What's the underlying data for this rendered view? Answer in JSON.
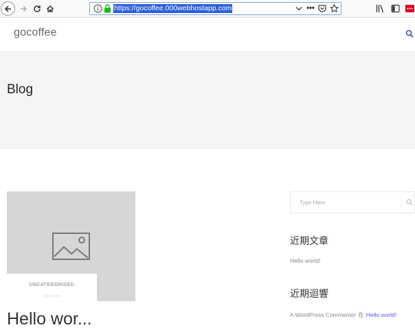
{
  "browser": {
    "url": "https://gocoffee.000webhostapp.com",
    "more_label": "•••"
  },
  "site": {
    "title": "gocoffee"
  },
  "page": {
    "title": "Blog"
  },
  "post": {
    "category": "UNCATEGORISED",
    "title": "Hello wor..."
  },
  "sidebar": {
    "search_placeholder": "Type Here",
    "recent_posts_heading": "近期文章",
    "recent_posts": [
      "Hello world!"
    ],
    "recent_comments_heading": "近期迴響",
    "comment": {
      "author": "A WordPress Commenter",
      "connector": "在",
      "post_title": "Hello world!"
    }
  },
  "colors": {
    "link_accent": "#5a5bd9",
    "url_highlight": "#2b5fd9",
    "lock_green": "#12bc00"
  }
}
